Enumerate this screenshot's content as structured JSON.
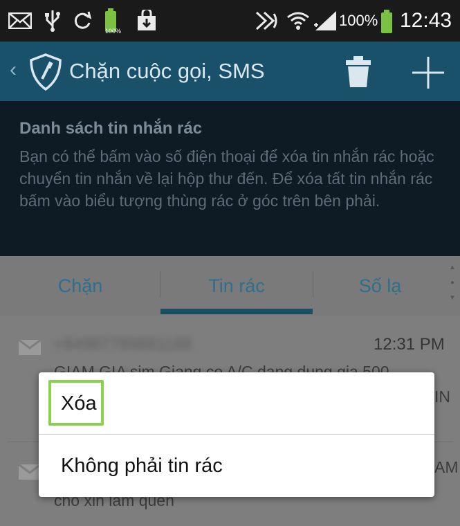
{
  "status_bar": {
    "icons": [
      "mail-icon",
      "usb-icon",
      "sync-icon",
      "battery-icon",
      "shopping-bag-icon",
      "nfc-icon",
      "wifi-icon",
      "signal-icon"
    ],
    "small_battery_label": "100%",
    "battery_percent": "100%",
    "time": "12:43",
    "battery_color": "#7bc143"
  },
  "action_bar": {
    "title": "Chặn cuộc gọi, SMS",
    "icons": [
      "back-chevron-icon",
      "shield-icon",
      "trash-icon",
      "plus-icon"
    ],
    "background": "#19506a"
  },
  "info_panel": {
    "title": "Danh sách tin nhắn rác",
    "description": "Bạn có thể bấm vào số điện thoại để xóa tin nhắn rác hoặc chuyển tin nhắn về lại hộp thư đến. Để xóa tất tin nhắn rác bấm vào biểu tượng thùng rác ở góc trên bên phải."
  },
  "tabs": [
    {
      "label": "Chặn",
      "selected": false
    },
    {
      "label": "Tin rác",
      "selected": true
    },
    {
      "label": "Số lạ",
      "selected": false
    }
  ],
  "messages": [
    {
      "sender": "+84987789881188",
      "time": "12:31 PM",
      "snippet": "GIAM GIA sim Giang co A/C dang dung gia 500",
      "tail": "IN"
    },
    {
      "sender": "",
      "time": "",
      "snippet": "cho xin lam quen",
      "tail": "AM"
    }
  ],
  "dialog": {
    "items": [
      "Xóa",
      "Không phải tin rác"
    ],
    "highlight_color": "#8bd150"
  }
}
